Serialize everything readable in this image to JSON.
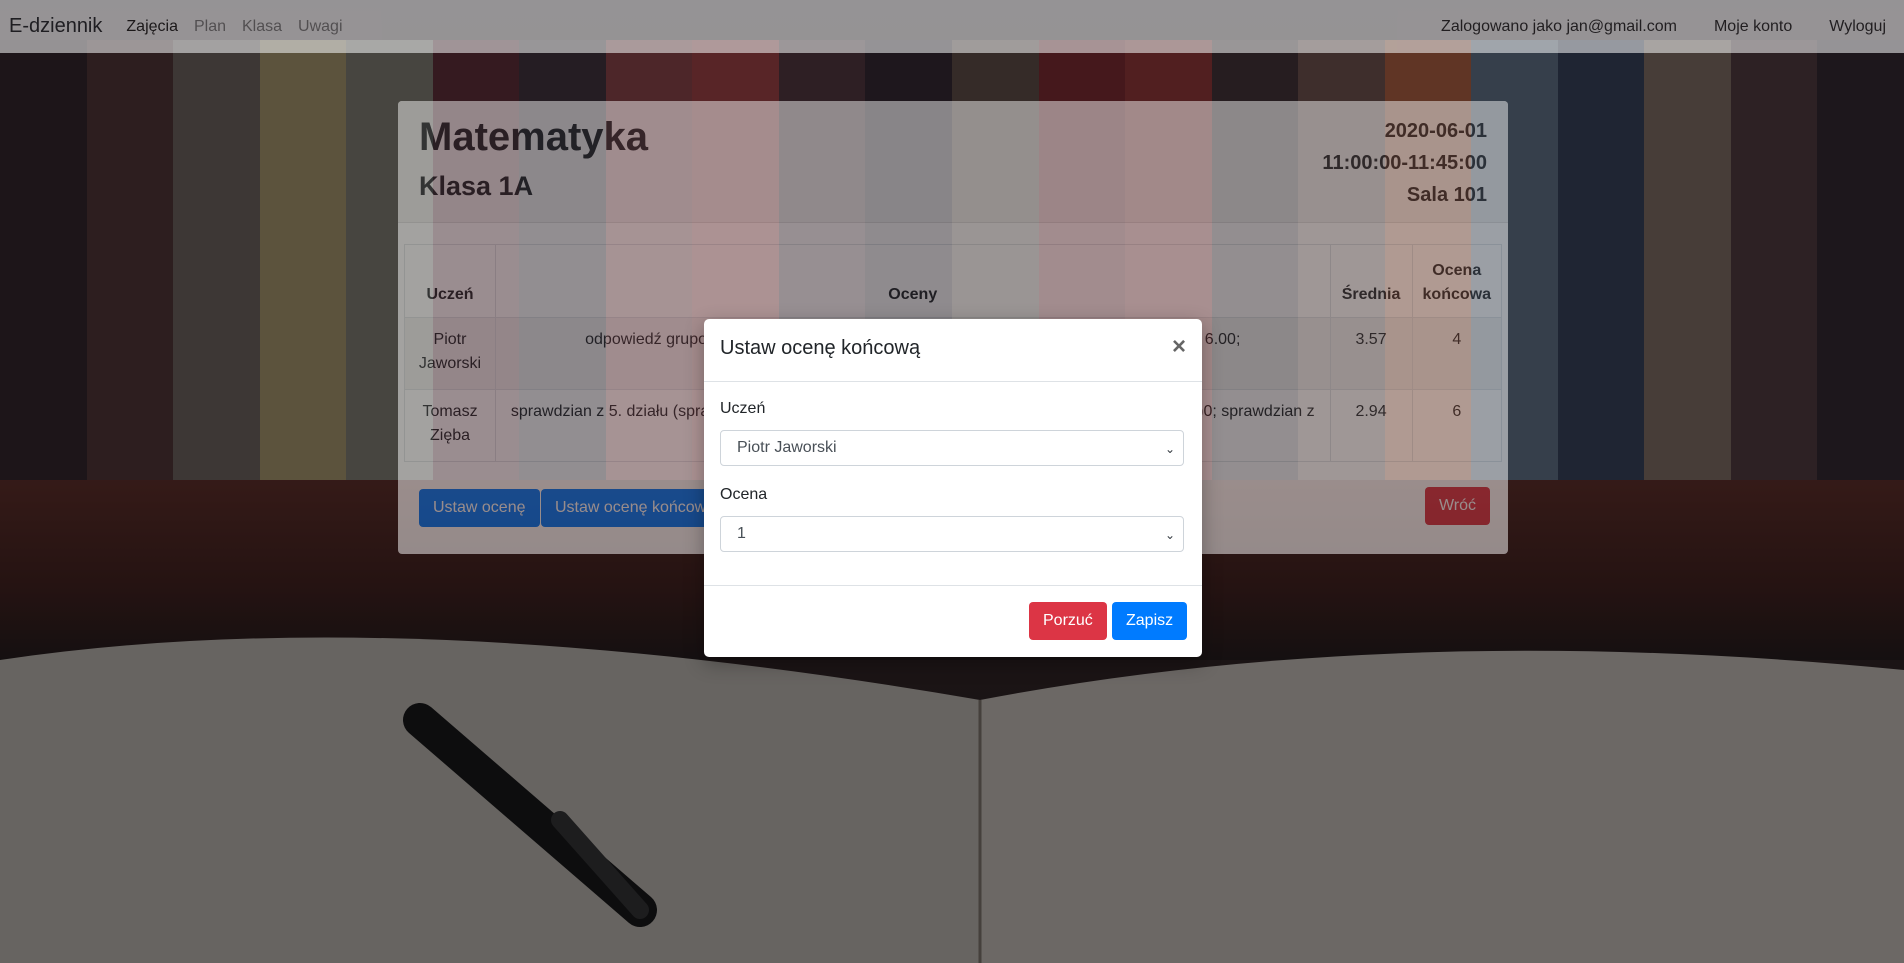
{
  "navbar": {
    "brand": "E-dziennik",
    "links": [
      "Zajęcia",
      "Plan",
      "Klasa",
      "Uwagi"
    ],
    "user_text": "Zalogowano jako jan@gmail.com",
    "account": "Moje konto",
    "logout": "Wyloguj"
  },
  "lesson": {
    "subject": "Matematyka",
    "class": "Klasa 1A",
    "date": "2020-06-01",
    "time": "11:00:00-11:45:00",
    "room": "Sala 101"
  },
  "table": {
    "headers": [
      "Uczeń",
      "Oceny",
      "Średnia",
      "Ocena końcowa"
    ],
    "rows": [
      {
        "student": "Piotr Jaworski",
        "grades_left": "odpowiedź grupo",
        "grades_right": ": 6.00;",
        "avg": "3.57",
        "final": "4"
      },
      {
        "student": "Tomasz Zięba",
        "grades_left": "sprawdzian z 5. działu (spra",
        "grades_right": ")0; sprawdzian z",
        "avg": "2.94",
        "final": "6"
      }
    ]
  },
  "actions": {
    "set_grade": "Ustaw ocenę",
    "set_final": "Ustaw ocenę końcową",
    "back": "Wróć"
  },
  "modal": {
    "title": "Ustaw ocenę końcową",
    "close": "×",
    "student_label": "Uczeń",
    "student_value": "Piotr Jaworski",
    "grade_label": "Ocena",
    "grade_value": "1",
    "cancel": "Porzuć",
    "save": "Zapisz"
  },
  "colors": {
    "primary": "#007bff",
    "danger": "#dc3545",
    "navbar_bg": "#f8f9fa"
  },
  "icons": {
    "close": "close-icon",
    "select_arrow": "chevron-down-icon"
  }
}
